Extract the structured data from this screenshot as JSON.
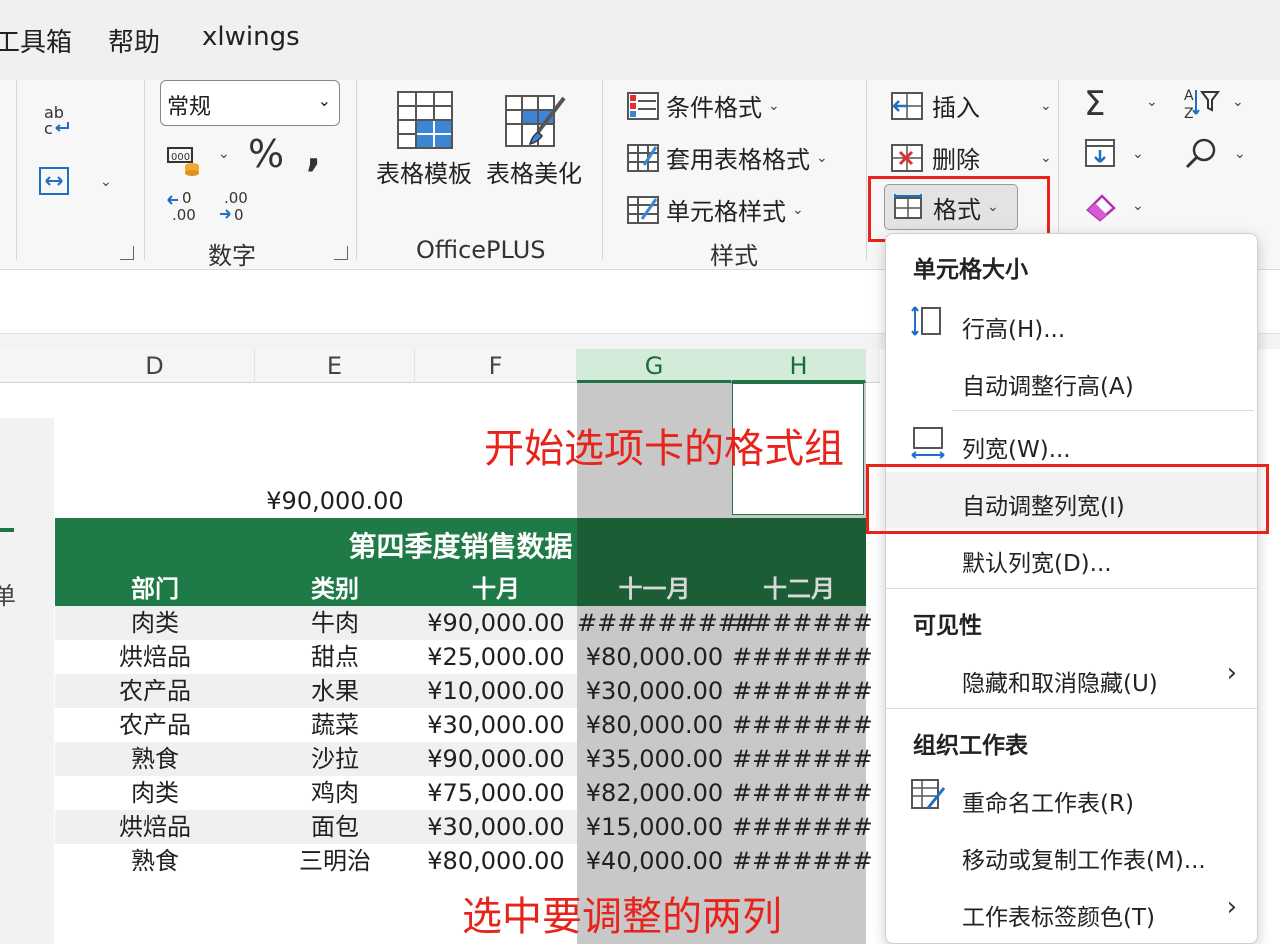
{
  "menubar": {
    "items": [
      "工具箱",
      "帮助",
      "xlwings"
    ]
  },
  "ribbon": {
    "number_group": {
      "format_value": "常规",
      "label": "数字"
    },
    "officeplus": {
      "template_label": "表格模板",
      "beautify_label": "表格美化",
      "label": "OfficePLUS"
    },
    "styles": {
      "conditional": "条件格式",
      "table_format": "套用表格格式",
      "cell_styles": "单元格样式",
      "label": "样式"
    },
    "cells": {
      "insert": "插入",
      "delete": "删除",
      "format": "格式"
    }
  },
  "sheet": {
    "columns": [
      "D",
      "E",
      "F",
      "G",
      "H"
    ],
    "total_value": "¥90,000.00",
    "title": "第四季度销售数据",
    "side_char": "单",
    "headers": [
      "部门",
      "类别",
      "十月",
      "十一月",
      "十二月"
    ],
    "rows": [
      [
        "肉类",
        "牛肉",
        "¥90,000.00",
        "#########",
        "#######"
      ],
      [
        "烘焙品",
        "甜点",
        "¥25,000.00",
        "¥80,000.00",
        "#######"
      ],
      [
        "农产品",
        "水果",
        "¥10,000.00",
        "¥30,000.00",
        "#######"
      ],
      [
        "农产品",
        "蔬菜",
        "¥30,000.00",
        "¥80,000.00",
        "#######"
      ],
      [
        "熟食",
        "沙拉",
        "¥90,000.00",
        "¥35,000.00",
        "#######"
      ],
      [
        "肉类",
        "鸡肉",
        "¥75,000.00",
        "¥82,000.00",
        "#######"
      ],
      [
        "烘焙品",
        "面包",
        "¥30,000.00",
        "¥15,000.00",
        "#######"
      ],
      [
        "熟食",
        "三明治",
        "¥80,000.00",
        "¥40,000.00",
        "#######"
      ]
    ]
  },
  "format_menu": {
    "cell_size_header": "单元格大小",
    "row_height": "行高(H)...",
    "autofit_row": "自动调整行高(A)",
    "col_width": "列宽(W)...",
    "autofit_col": "自动调整列宽(I)",
    "default_width": "默认列宽(D)...",
    "visibility_header": "可见性",
    "hide_unhide": "隐藏和取消隐藏(U)",
    "organize_header": "组织工作表",
    "rename": "重命名工作表(R)",
    "move_copy": "移动或复制工作表(M)...",
    "tab_color": "工作表标签颜色(T)"
  },
  "annotations": {
    "format_group": "开始选项卡的格式组",
    "select_cols": "选中要调整的两列"
  },
  "colors": {
    "excel_green": "#217346",
    "header_green": "#1e6e42",
    "annotation_red": "#e8231b"
  }
}
